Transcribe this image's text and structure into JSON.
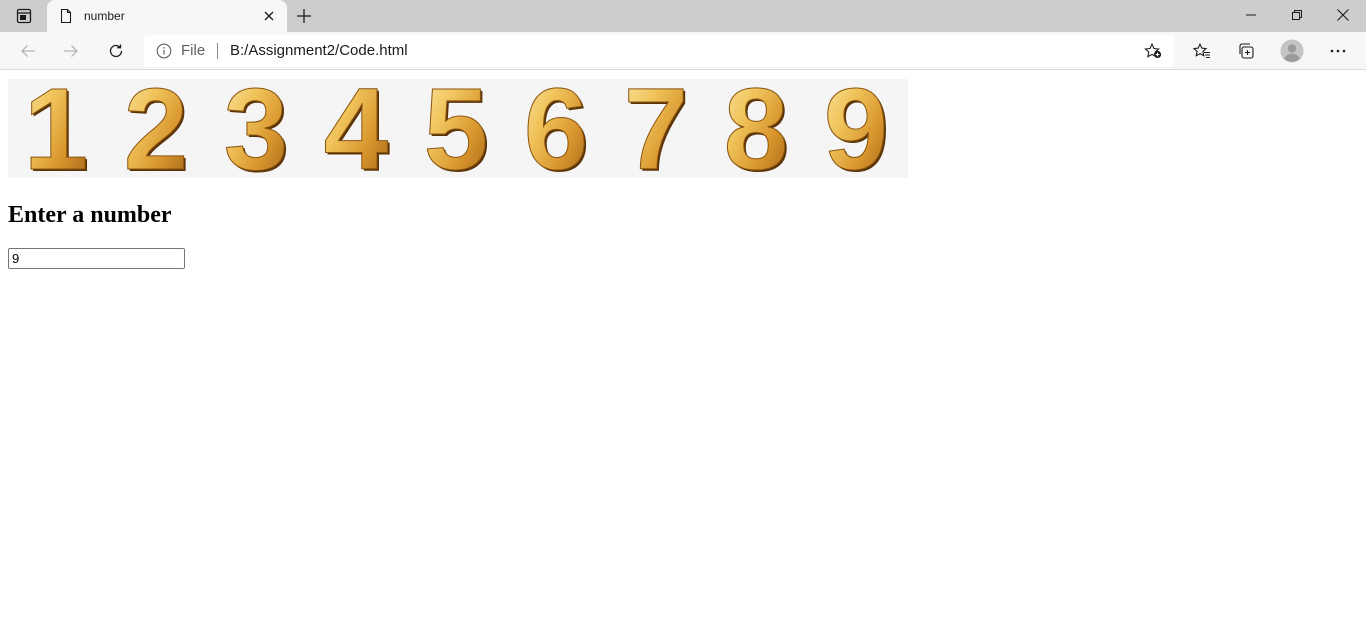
{
  "browser": {
    "tab": {
      "title": "number"
    },
    "address": {
      "scheme_label": "File",
      "url": "B:/Assignment2/Code.html"
    }
  },
  "page": {
    "banner_digits": [
      "1",
      "2",
      "3",
      "4",
      "5",
      "6",
      "7",
      "8",
      "9"
    ],
    "heading": "Enter a number",
    "input_value": "9"
  },
  "colors": {
    "tabstrip": "#cdcdcd",
    "toolbar": "#f7f7f7",
    "gold_light": "#f6d98a",
    "gold_mid": "#d9a23a",
    "gold_dark": "#7a4a0c"
  },
  "icons": [
    "tab-actions-icon",
    "page-icon",
    "close-icon",
    "plus-icon",
    "minimize-icon",
    "restore-icon",
    "window-close-icon",
    "back-arrow-icon",
    "forward-arrow-icon",
    "reload-icon",
    "info-icon",
    "add-favorite-icon",
    "favorites-icon",
    "collections-icon",
    "profile-icon",
    "more-icon"
  ]
}
